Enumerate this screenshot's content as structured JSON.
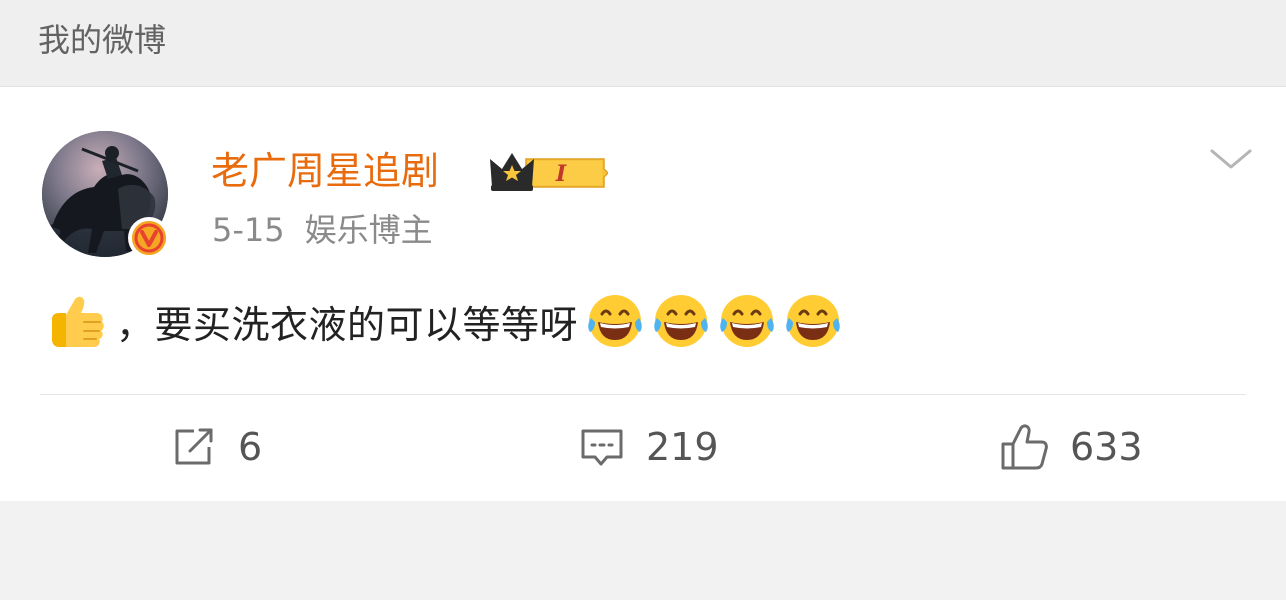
{
  "page": {
    "title": "我的微博"
  },
  "post": {
    "author": {
      "name": "老广周星追剧",
      "vip_level": "I",
      "verified": true
    },
    "date": "5-15",
    "category": "娱乐博主",
    "content": {
      "lead_emoji": "thumbs-up-icon",
      "text": "，要买洗衣液的可以等等呀",
      "trailing_emojis": [
        "laughing-tears-icon",
        "laughing-tears-icon",
        "laughing-tears-icon",
        "laughing-tears-icon"
      ]
    },
    "actions": {
      "repost_count": "6",
      "comment_count": "219",
      "like_count": "633"
    }
  },
  "colors": {
    "username": "#e86b0e",
    "verified_badge": "#f5a623",
    "page_bg": "#f2f2f2",
    "card_bg": "#ffffff"
  }
}
